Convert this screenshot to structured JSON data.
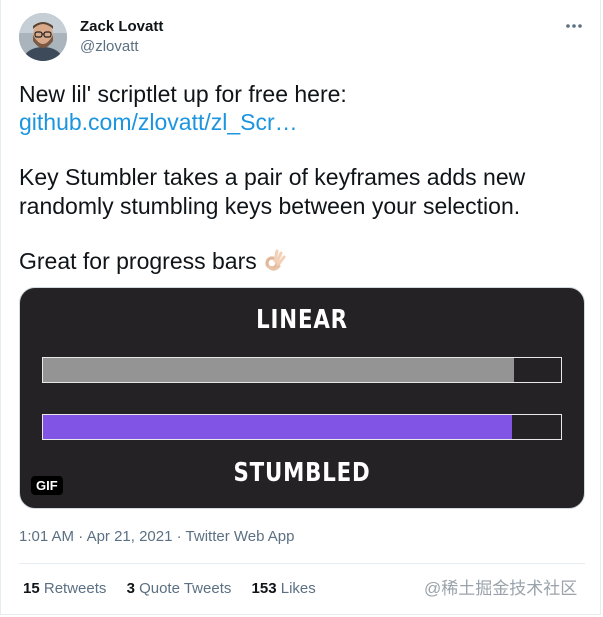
{
  "author": {
    "name": "Zack Lovatt",
    "handle": "@zlovatt"
  },
  "tweet": {
    "line1": "New lil' scriptlet up for free here:",
    "link": "github.com/zlovatt/zl_Scr…",
    "line3": "Key Stumbler takes a pair of keyframes adds new",
    "line4": "randomly stumbling keys between your selection.",
    "line5": "Great for progress bars",
    "emoji": "ok-hand-emoji"
  },
  "media": {
    "label_top": "LINEAR",
    "label_bottom": "STUMBLED",
    "badge": "GIF",
    "bars": [
      {
        "name": "linear",
        "progress": 0.91,
        "color": "#949494"
      },
      {
        "name": "stumbled",
        "progress": 0.906,
        "color": "#8154e6"
      }
    ]
  },
  "meta": {
    "time": "1:01 AM",
    "separator": "·",
    "date": "Apr 21, 2021",
    "source": "Twitter Web App"
  },
  "stats": {
    "retweets_count": "15",
    "retweets_label": "Retweets",
    "quotes_count": "3",
    "quotes_label": "Quote Tweets",
    "likes_count": "153",
    "likes_label": "Likes"
  },
  "watermark": "@稀土掘金技术社区",
  "colors": {
    "link": "#1b95e0",
    "secondary_text": "#5b7083",
    "media_bg": "#252226"
  }
}
